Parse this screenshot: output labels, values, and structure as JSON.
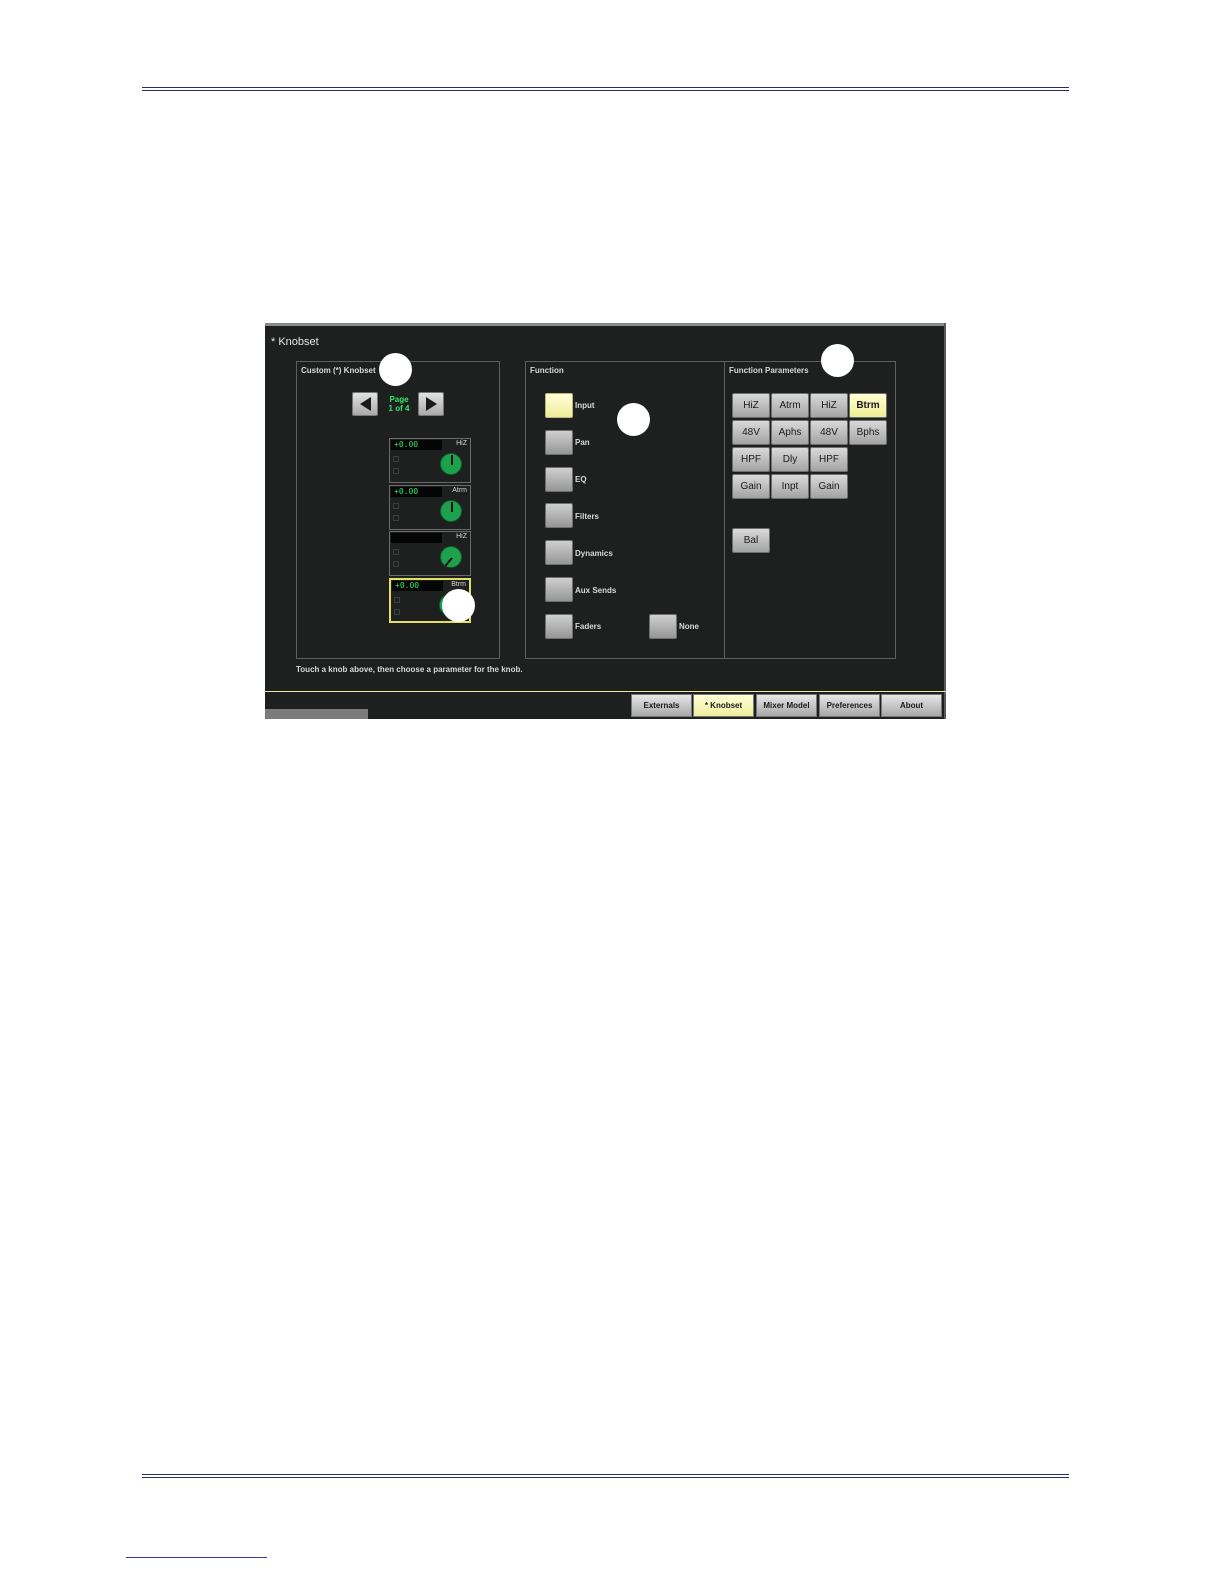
{
  "screen": {
    "title": "* Knobset",
    "custom_panel": {
      "title": "Custom (*) Knobset",
      "page_label_line1": "Page",
      "page_label_line2": "1 of 4",
      "knobs": [
        {
          "value": "+0.00",
          "param": "HiZ"
        },
        {
          "value": "+0.00",
          "param": "Atrm"
        },
        {
          "value": "",
          "param": "HiZ"
        },
        {
          "value": "+0.00",
          "param": "Btrm"
        }
      ]
    },
    "function_panel": {
      "title": "Function",
      "items": [
        "Input",
        "Pan",
        "EQ",
        "Filters",
        "Dynamics",
        "Aux Sends",
        "Faders"
      ],
      "none_label": "None"
    },
    "params_panel": {
      "title": "Function Parameters",
      "rows": [
        [
          "HiZ",
          "Atrm",
          "HiZ",
          "Btrm"
        ],
        [
          "48V",
          "Aphs",
          "48V",
          "Bphs"
        ],
        [
          "HPF",
          "Dly",
          "HPF"
        ],
        [
          "Gain",
          "Inpt",
          "Gain"
        ]
      ],
      "extra": "Bal"
    },
    "hint": "Touch a knob above, then choose a parameter for the knob.",
    "tabs": [
      "Externals",
      "* Knobset",
      "Mixer Model",
      "Preferences",
      "About"
    ]
  },
  "colors": {
    "background": "#1e1f1f",
    "meter_green": "#2ee86a",
    "knob_green": "#1ea14c",
    "active_yellow": "#f4f4b0"
  }
}
